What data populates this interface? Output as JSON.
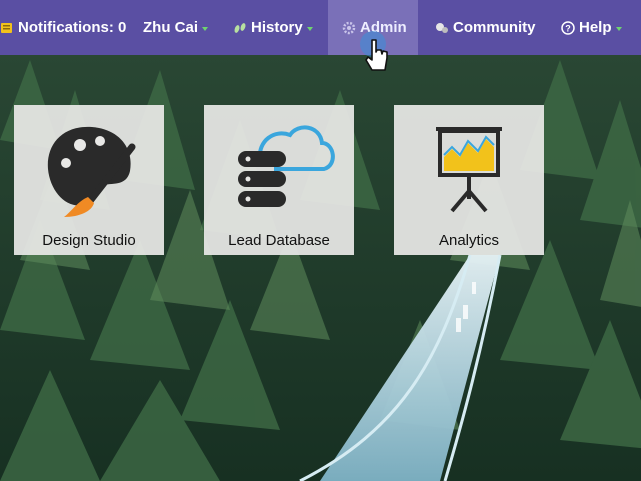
{
  "nav": {
    "notifications": "Notifications: 0",
    "user": "Zhu Cai",
    "history": "History",
    "admin": "Admin",
    "community": "Community",
    "help": "Help"
  },
  "tiles": [
    {
      "label": "Design Studio",
      "icon": "palette-icon"
    },
    {
      "label": "Lead Database",
      "icon": "database-cloud-icon"
    },
    {
      "label": "Analytics",
      "icon": "presentation-chart-icon"
    }
  ],
  "colors": {
    "nav_bg": "#5a4fa3",
    "nav_active": "#7a70b8",
    "caret": "#6fd46f",
    "tile_bg": "#e8e8e6",
    "accent_blue": "#3aa6dd",
    "accent_orange": "#f08a24",
    "accent_yellow": "#f2c21b"
  }
}
